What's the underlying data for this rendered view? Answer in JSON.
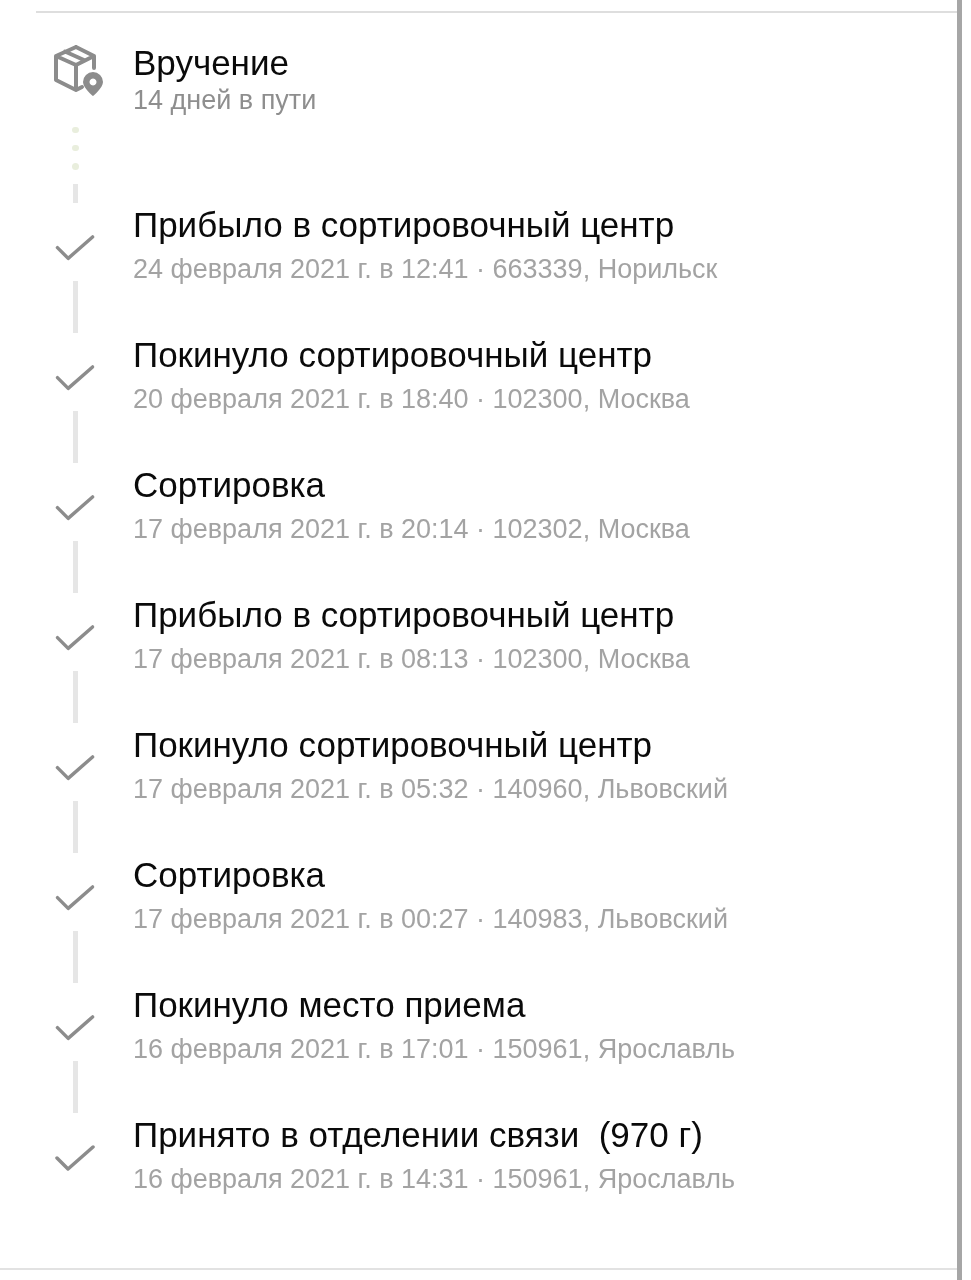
{
  "header": {
    "title": "Вручение",
    "subtitle": "14 дней в пути"
  },
  "events": [
    {
      "title": "Прибыло в сортировочный центр",
      "details": "24 февраля 2021 г. в 12:41 · 663339, Норильск",
      "completed": true
    },
    {
      "title": "Покинуло сортировочный центр",
      "details": "20 февраля 2021 г. в 18:40 · 102300, Москва",
      "completed": true
    },
    {
      "title": "Сортировка",
      "details": "17 февраля 2021 г. в 20:14 · 102302, Москва",
      "completed": true
    },
    {
      "title": "Прибыло в сортировочный центр",
      "details": "17 февраля 2021 г. в 08:13 · 102300, Москва",
      "completed": true
    },
    {
      "title": "Покинуло сортировочный центр",
      "details": "17 февраля 2021 г. в 05:32 · 140960, Львовский",
      "completed": true
    },
    {
      "title": "Сортировка",
      "details": "17 февраля 2021 г. в 00:27 · 140983, Львовский",
      "completed": true
    },
    {
      "title": "Покинуло место приема",
      "details": "16 февраля 2021 г. в 17:01 · 150961, Ярославль",
      "completed": true
    },
    {
      "title": "Принято в отделении связи  (970 г)",
      "details": "16 февраля 2021 г. в 14:31 · 150961, Ярославль",
      "completed": true
    }
  ]
}
